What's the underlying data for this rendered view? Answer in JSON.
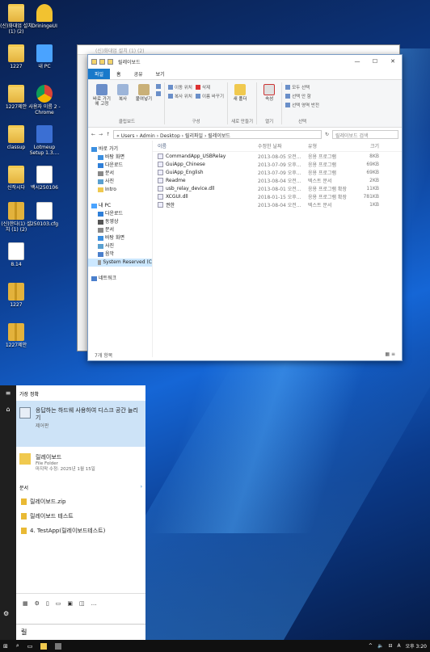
{
  "desktop": {
    "icons": [
      {
        "label": "(신)화대업 설치 (1) (2)",
        "kind": "folder"
      },
      {
        "label": "DriningeUI",
        "kind": "key"
      },
      {
        "label": "1227",
        "kind": "folder"
      },
      {
        "label": "내 PC",
        "kind": "pc"
      },
      {
        "label": "1227제안",
        "kind": "folder"
      },
      {
        "label": "사용자 이름 2 - Chrome",
        "kind": "chrome"
      },
      {
        "label": "classup",
        "kind": "folder"
      },
      {
        "label": "Lotmeup Setup 1.3....",
        "kind": "app"
      },
      {
        "label": "신작시다",
        "kind": "folder"
      },
      {
        "label": "백시250106",
        "kind": "file"
      },
      {
        "label": "(신)한다(1) 설치 (1) (2)",
        "kind": "zip"
      },
      {
        "label": "250103.cfg",
        "kind": "file"
      },
      {
        "label": "8.14",
        "kind": "file"
      },
      {
        "label": "1227",
        "kind": "zip"
      },
      {
        "label": "1227제안",
        "kind": "zip"
      }
    ]
  },
  "explorer_back": {
    "title": "(신)화대업 설치 (1) (2)"
  },
  "explorer": {
    "title": "릴레이보드",
    "tabs": [
      "파일",
      "홈",
      "공유",
      "보기"
    ],
    "ribbon": {
      "clipboard": {
        "pin": "바로 가기에 고정",
        "copy": "복사",
        "paste": "붙여넣기",
        "label": "클립보드"
      },
      "organize": {
        "move": "이동 위치",
        "copyto": "복사 위치",
        "delete": "삭제",
        "rename": "이름 바꾸기",
        "label": "구성"
      },
      "new": {
        "newfolder": "새 폴더",
        "label": "새로 만들기"
      },
      "open": {
        "props": "속성",
        "label": "열기"
      },
      "select": {
        "all": "모두 선택",
        "none": "선택 안 함",
        "invert": "선택 영역 반전",
        "label": "선택"
      }
    },
    "address": "«  Users  ›  Admin  ›  Desktop  ›  릴리파일  ›  릴레이보드",
    "search_placeholder": "릴레이보드 검색",
    "nav": [
      {
        "label": "바로 가기",
        "kind": "star"
      },
      {
        "label": "바탕 화면",
        "kind": "blue"
      },
      {
        "label": "다운로드",
        "kind": "down"
      },
      {
        "label": "문서",
        "kind": "doc"
      },
      {
        "label": "사진",
        "kind": "pic"
      },
      {
        "label": "Intro",
        "kind": "folder"
      },
      {
        "label": "",
        "kind": "none"
      },
      {
        "label": "내 PC",
        "kind": "pc"
      },
      {
        "label": "다운로드",
        "kind": "down"
      },
      {
        "label": "동영상",
        "kind": "vid"
      },
      {
        "label": "문서",
        "kind": "doc"
      },
      {
        "label": "바탕 화면",
        "kind": "blue"
      },
      {
        "label": "사진",
        "kind": "pic"
      },
      {
        "label": "음악",
        "kind": "music"
      },
      {
        "label": "System Reserved (C",
        "kind": "drive"
      },
      {
        "label": "",
        "kind": "none"
      },
      {
        "label": "네트워크",
        "kind": "net"
      }
    ],
    "columns": {
      "name": "이름",
      "date": "수정한 날짜",
      "type": "유형",
      "size": "크기"
    },
    "files": [
      {
        "name": "CommandApp_USBRelay",
        "date": "2013-08-05 오전...",
        "type": "응용 프로그램",
        "size": "8KB"
      },
      {
        "name": "GuiApp_Chinese",
        "date": "2013-07-09 오후...",
        "type": "응용 프로그램",
        "size": "69KB"
      },
      {
        "name": "GuiApp_English",
        "date": "2013-07-09 오후...",
        "type": "응용 프로그램",
        "size": "69KB"
      },
      {
        "name": "Readme",
        "date": "2013-08-04 오전...",
        "type": "텍스트 문서",
        "size": "2KB"
      },
      {
        "name": "usb_relay_device.dll",
        "date": "2013-08-01 오전...",
        "type": "응용 프로그램 확장",
        "size": "11KB"
      },
      {
        "name": "XCGUI.dll",
        "date": "2018-01-15 오후...",
        "type": "응용 프로그램 확장",
        "size": "781KB"
      },
      {
        "name": "권한",
        "date": "2013-08-04 오전...",
        "type": "텍스트 문서",
        "size": "1KB"
      }
    ],
    "status": "7개 항목"
  },
  "start_menu": {
    "best_match_header": "가장 정확",
    "best_match": {
      "title": "응답하는 하드웨 사용하여 디스크 공간 늘리기",
      "subtitle": "제어판"
    },
    "second": {
      "title": "릴레이보드",
      "subtitle": "File Folder",
      "meta": "마지막 수정: 2025년 1월 15일"
    },
    "docs_header": "문서",
    "docs_more": "›",
    "docs": [
      "릴레이보드.zip",
      "릴레이보드 테스트",
      "4. TestApp(릴레이보드테스트)"
    ],
    "search_text": "릴"
  },
  "taskbar": {
    "time": "오후 3:20",
    "lang": "A"
  }
}
